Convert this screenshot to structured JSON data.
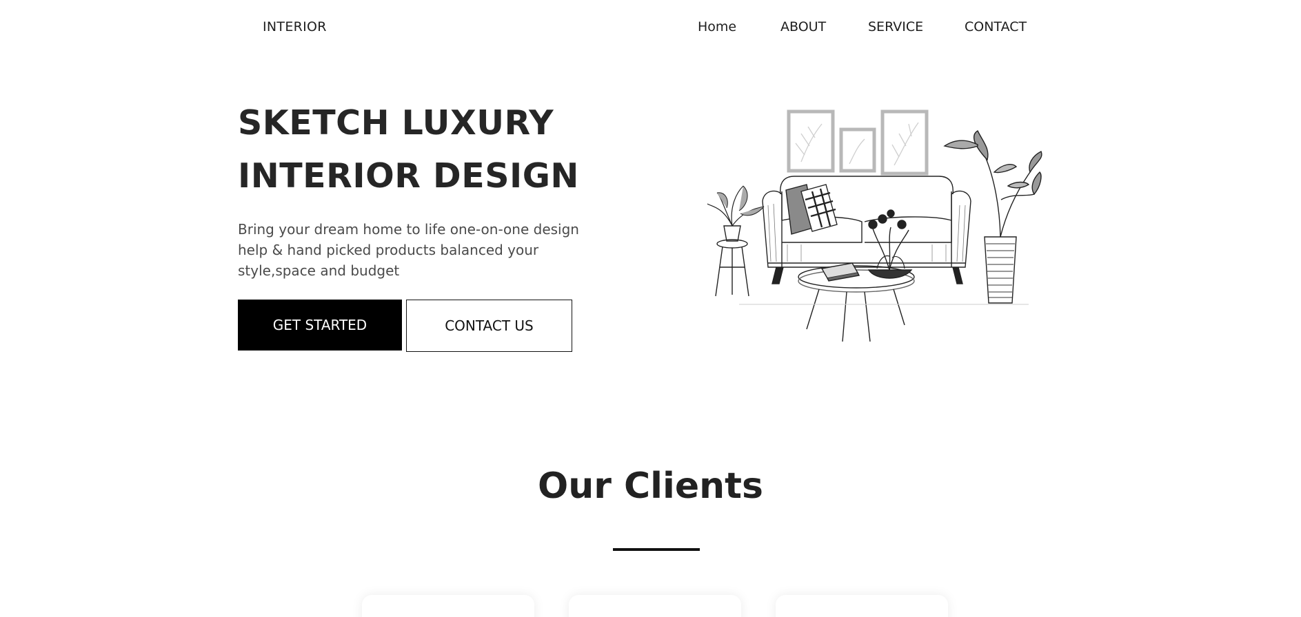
{
  "header": {
    "logo": "INTERIOR",
    "nav": {
      "home": "Home",
      "about": "ABOUT",
      "service": "SERVICE",
      "contact": "CONTACT"
    }
  },
  "hero": {
    "title_line1": "SKETCH LUXURY",
    "title_line2": "INTERIOR DESIGN",
    "description": "Bring your dream home to life one-on-one design help & hand picked products balanced your style,space and budget",
    "primary_button": "GET STARTED",
    "secondary_button": "CONTACT US",
    "illustration": "sketch-living-room-illustration"
  },
  "clients": {
    "title": "Our Clients"
  },
  "colors": {
    "text": "#262626",
    "button_primary_bg": "#000000",
    "button_primary_text": "#ffffff",
    "underline": "#111111"
  }
}
